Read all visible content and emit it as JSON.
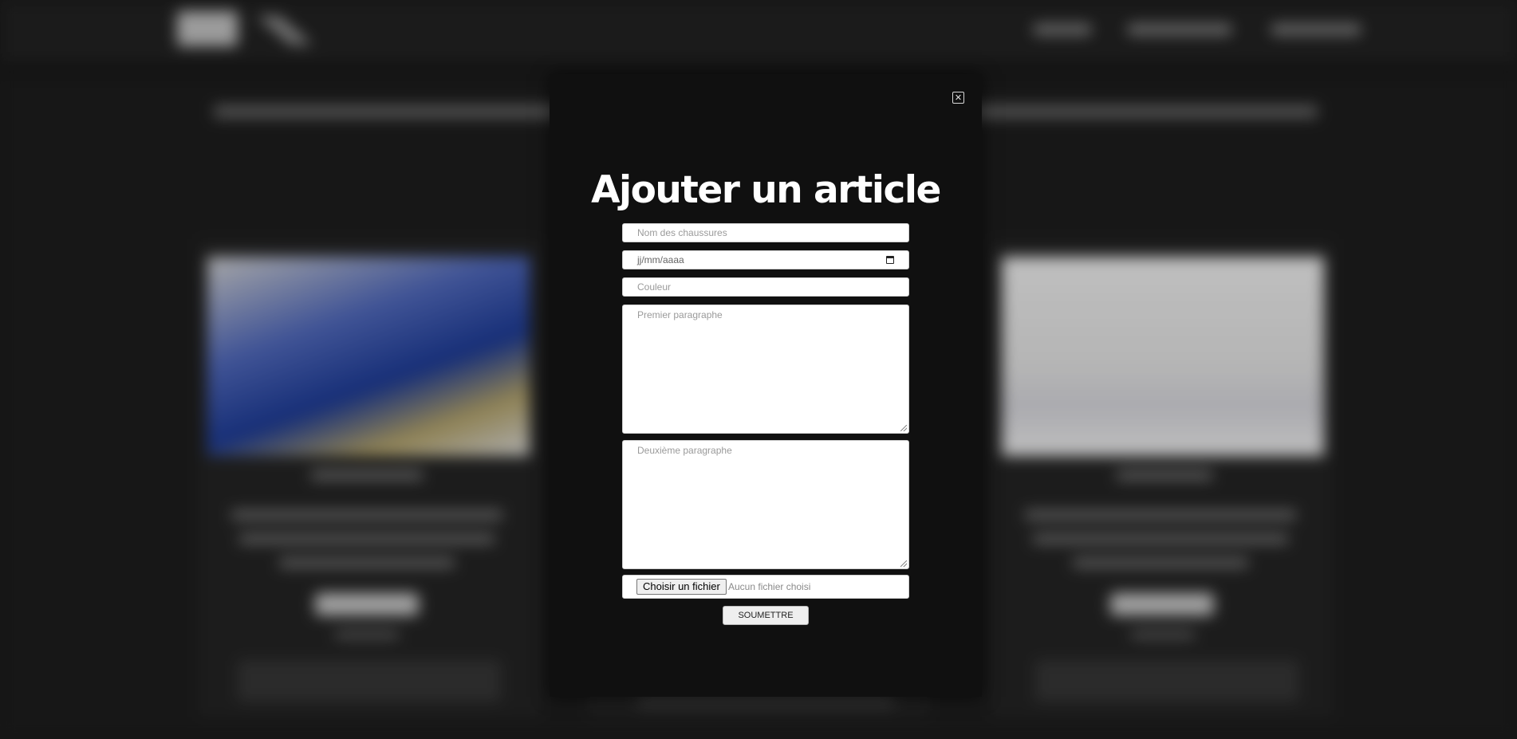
{
  "modal": {
    "title": "Ajouter un article",
    "close_icon": "close-icon",
    "fields": {
      "name_placeholder": "Nom des chaussures",
      "date_placeholder": "jj/mm/aaaa",
      "color_placeholder": "Couleur",
      "paragraph1_placeholder": "Premier paragraphe",
      "paragraph2_placeholder": "Deuxième paragraphe"
    },
    "file": {
      "button_label": "Choisir un fichier",
      "status": "Aucun fichier choisi"
    },
    "submit_label": "SOUMETTRE"
  },
  "colors": {
    "modal_bg": "#101010",
    "page_bg": "#1e1e1e",
    "title": "#ffffff"
  }
}
